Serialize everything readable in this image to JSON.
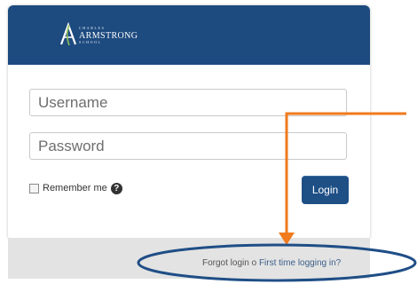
{
  "brand": {
    "name_top": "CHARLES",
    "name_main": "ARMSTRONG",
    "name_bottom": "SCHOOL"
  },
  "form": {
    "username_placeholder": "Username",
    "password_placeholder": "Password",
    "remember_label": "Remember me",
    "help_symbol": "?",
    "login_label": "Login"
  },
  "footer": {
    "forgot_label": "Forgot login",
    "separator": "o",
    "first_time_label": "First time logging in?"
  },
  "colors": {
    "header": "#1d4a7f",
    "login_button": "#1e4f85",
    "annotation_arrow": "#f07a1d",
    "annotation_ellipse": "#1f4e86"
  }
}
